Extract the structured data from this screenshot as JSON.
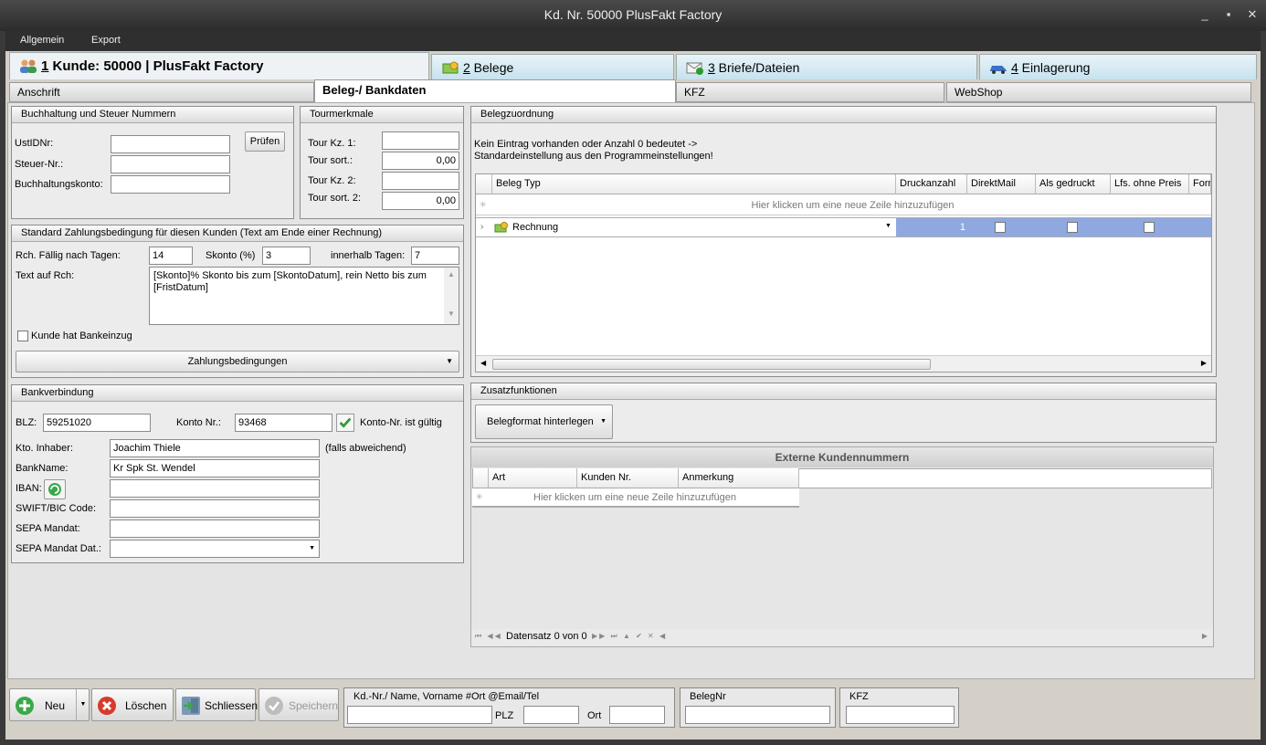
{
  "window": {
    "title": "Kd. Nr. 50000 PlusFakt Factory",
    "min": "_",
    "max": "▪",
    "close": "✕"
  },
  "menu": [
    "Allgemein",
    "Export"
  ],
  "main_tabs": [
    {
      "num": "1",
      "label": " Kunde: 50000 | PlusFakt Factory"
    },
    {
      "num": "2",
      "label": " Belege"
    },
    {
      "num": "3",
      "label": " Briefe/Dateien"
    },
    {
      "num": "4",
      "label": " Einlagerung"
    }
  ],
  "sub_tabs": [
    "Anschrift",
    "Beleg-/ Bankdaten",
    "KFZ",
    "WebShop"
  ],
  "buchhaltung": {
    "title": "Buchhaltung und Steuer Nummern",
    "ustid_label": "UstIDNr:",
    "ustid_value": "",
    "steuer_label": "Steuer-Nr.:",
    "steuer_value": "",
    "konto_label": "Buchhaltungskonto:",
    "konto_value": "",
    "pruefen": "Prüfen"
  },
  "tour": {
    "title": "Tourmerkmale",
    "kz1_label": "Tour Kz. 1:",
    "kz1_value": "",
    "sort1_label": "Tour sort.:",
    "sort1_value": "0,00",
    "kz2_label": "Tour Kz. 2:",
    "kz2_value": "",
    "sort2_label": "Tour sort. 2:",
    "sort2_value": "0,00"
  },
  "zahlung": {
    "title": "Standard Zahlungsbedingung für diesen Kunden (Text am Ende einer Rechnung)",
    "faellig_label": "Rch. Fällig nach Tagen:",
    "faellig_value": "14",
    "skonto_label": "Skonto (%)",
    "skonto_value": "3",
    "innerhalb_label": "innerhalb Tagen:",
    "innerhalb_value": "7",
    "text_label": "Text auf Rch:",
    "text_value": "[Skonto]% Skonto bis zum [SkontoDatum], rein Netto bis zum [FristDatum]",
    "bankeinzug_label": "Kunde hat Bankeinzug",
    "bankeinzug_checked": false,
    "button": "Zahlungsbedingungen"
  },
  "bank": {
    "title": "Bankverbindung",
    "blz_label": "BLZ:",
    "blz_value": "59251020",
    "konto_label": "Konto Nr.:",
    "konto_value": "93468",
    "konto_status": "Konto-Nr. ist gültig",
    "inhaber_label": "Kto. Inhaber:",
    "inhaber_value": "Joachim Thiele",
    "inhaber_note": "(falls abweichend)",
    "bankname_label": "BankName:",
    "bankname_value": "Kr Spk St. Wendel",
    "iban_label": "IBAN:",
    "iban_value": "",
    "swift_label": "SWIFT/BIC Code:",
    "swift_value": "",
    "sepa_label": "SEPA Mandat:",
    "sepa_value": "",
    "sepadat_label": "SEPA Mandat Dat.:",
    "sepadat_value": ""
  },
  "belegzuordnung": {
    "title": "Belegzuordnung",
    "info": "Kein Eintrag vorhanden oder Anzahl 0 bedeutet -> Standardeinstellung aus den Programmeinstellungen!",
    "columns": [
      "Beleg Typ",
      "Druckanzahl",
      "DirektMail",
      "Als gedruckt",
      "Lfs. ohne Preis",
      "Forr"
    ],
    "new_row_hint": "Hier klicken um eine neue Zeile hinzuzufügen",
    "rows": [
      {
        "typ": "Rechnung",
        "druckanzahl": "1",
        "direktmail": false,
        "als_gedruckt": false,
        "lfs_ohne_preis": false
      }
    ]
  },
  "zusatz": {
    "title": "Zusatzfunktionen",
    "button": "Belegformat hinterlegen"
  },
  "extern": {
    "title": "Externe Kundennummern",
    "columns": [
      "Art",
      "Kunden Nr.",
      "Anmerkung"
    ],
    "new_row_hint": "Hier klicken um eine neue Zeile hinzuzufügen",
    "nav_text": "Datensatz 0 von 0"
  },
  "bottom": {
    "neu": "Neu",
    "loeschen": "Löschen",
    "schliessen": "Schliessen",
    "speichern": "Speichern",
    "search_title": "Kd.-Nr./ Name, Vorname #Ort @Email/Tel",
    "plz_label": "PLZ",
    "ort_label": "Ort",
    "belegnr_title": "BelegNr",
    "kfz_title": "KFZ"
  },
  "colors": {
    "accent_row": "#8fa8e0",
    "tab_active": "#e9f4f9",
    "valid_green": "#2e9a2e"
  }
}
